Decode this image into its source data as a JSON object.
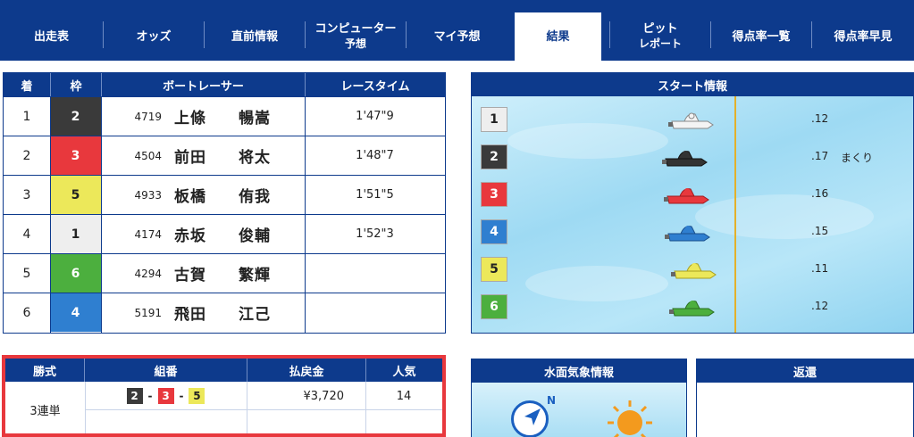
{
  "nav": {
    "items": [
      {
        "label": "出走表",
        "sub": ""
      },
      {
        "label": "オッズ",
        "sub": ""
      },
      {
        "label": "直前情報",
        "sub": ""
      },
      {
        "label": "コンピューター",
        "sub": "予想"
      },
      {
        "label": "マイ予想",
        "sub": ""
      },
      {
        "label": "結果",
        "sub": ""
      },
      {
        "label": "ピット",
        "sub": "レポート"
      },
      {
        "label": "得点率一覧",
        "sub": ""
      },
      {
        "label": "得点率早見",
        "sub": ""
      }
    ],
    "active_index": 5
  },
  "result_table": {
    "headers": {
      "rank": "着",
      "waku": "枠",
      "racer": "ボートレーサー",
      "time": "レースタイム"
    },
    "rows": [
      {
        "rank": "1",
        "waku": "2",
        "reg": "4719",
        "name": "上條　　暢嵩",
        "time": "1'47\"9"
      },
      {
        "rank": "2",
        "waku": "3",
        "reg": "4504",
        "name": "前田　　将太",
        "time": "1'48\"7"
      },
      {
        "rank": "3",
        "waku": "5",
        "reg": "4933",
        "name": "板橋　　侑我",
        "time": "1'51\"5"
      },
      {
        "rank": "4",
        "waku": "1",
        "reg": "4174",
        "name": "赤坂　　俊輔",
        "time": "1'52\"3"
      },
      {
        "rank": "5",
        "waku": "6",
        "reg": "4294",
        "name": "古賀　　繁輝",
        "time": ""
      },
      {
        "rank": "6",
        "waku": "4",
        "reg": "5191",
        "name": "飛田　　江己",
        "time": ""
      }
    ]
  },
  "start_info": {
    "title": "スタート情報",
    "rows": [
      {
        "waku": "1",
        "st": ".12",
        "kimarite": ""
      },
      {
        "waku": "2",
        "st": ".17",
        "kimarite": "まくり"
      },
      {
        "waku": "3",
        "st": ".16",
        "kimarite": ""
      },
      {
        "waku": "4",
        "st": ".15",
        "kimarite": ""
      },
      {
        "waku": "5",
        "st": ".11",
        "kimarite": ""
      },
      {
        "waku": "6",
        "st": ".12",
        "kimarite": ""
      }
    ]
  },
  "payout": {
    "headers": {
      "type": "勝式",
      "combo": "組番",
      "amount": "払戻金",
      "popularity": "人気"
    },
    "type": "3連単",
    "combo": [
      "2",
      "3",
      "5"
    ],
    "amount": "¥3,720",
    "popularity": "14"
  },
  "weather": {
    "title": "水面気象情報",
    "north": "N"
  },
  "henkan": {
    "title": "返還"
  },
  "colors": {
    "navy": "#0d3a8c",
    "highlight_border": "#e8383d",
    "waku1": "#eeeeee",
    "waku2": "#3a3a3a",
    "waku3": "#e8383d",
    "waku4": "#2f7fd0",
    "waku5": "#ece85a",
    "waku6": "#4caf3e"
  }
}
